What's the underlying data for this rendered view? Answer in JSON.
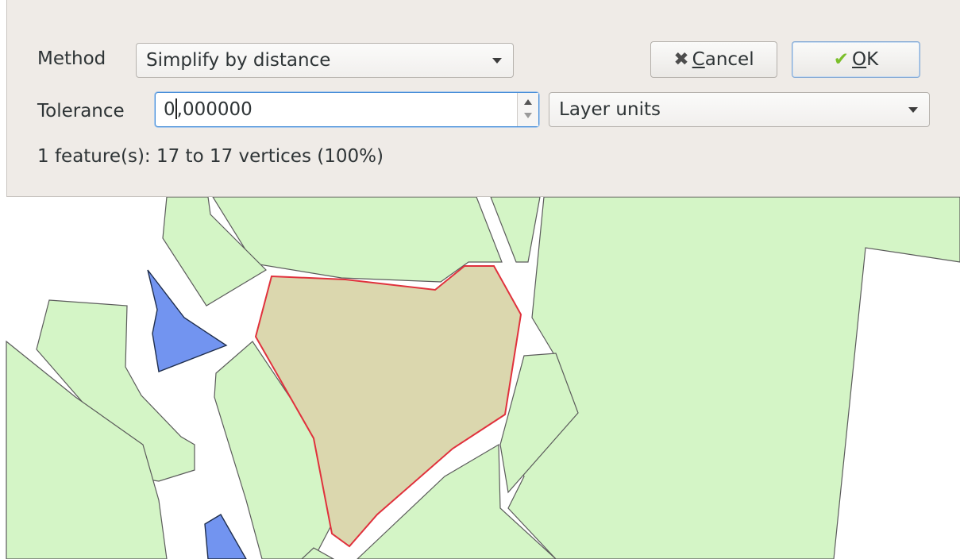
{
  "dialog": {
    "method_label": "Method",
    "method_value": "Simplify by distance",
    "tolerance_label": "Tolerance",
    "tolerance_value_before_caret": "0",
    "tolerance_value_after_caret": ",000000",
    "units_value": "Layer units",
    "cancel_label": "Cancel",
    "cancel_mnemonic": "C",
    "cancel_rest": "ancel",
    "ok_mnemonic": "O",
    "ok_rest": "K",
    "status_text": "1 feature(s): 17 to 17 vertices (100%)"
  },
  "icons": {
    "cancel": "x-icon",
    "ok": "check-icon"
  },
  "colors": {
    "field_green": "#d4f5c6",
    "water_blue": "#7294f0",
    "selected_fill": "#dbd7ae",
    "selection_outline": "#e0313c",
    "panel_bg": "#efebe7",
    "focus_blue": "#4a90d9"
  }
}
